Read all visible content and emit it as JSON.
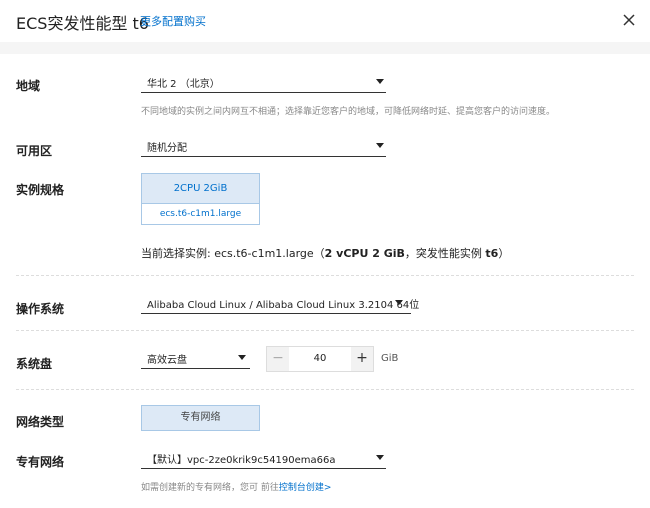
{
  "header": {
    "title": "ECS突发性能型 t6",
    "more_link": "更多配置购买"
  },
  "region": {
    "label": "地域",
    "value": "华北 2 （北京）",
    "hint": "不同地域的实例之间内网互不相通；选择靠近您客户的地域，可降低网络时延、提高您客户的访问速度。"
  },
  "zone": {
    "label": "可用区",
    "value": "随机分配"
  },
  "spec": {
    "label": "实例规格",
    "cpu_mem": "2CPU 2GiB",
    "type_name": "ecs.t6-c1m1.large",
    "current_prefix": "当前选择实例: ecs.t6-c1m1.large（",
    "current_bold": "2 vCPU 2 GiB",
    "current_mid": "，突发性能实例 ",
    "current_bold2": "t6",
    "current_suffix": "）"
  },
  "os": {
    "label": "操作系统",
    "value": "Alibaba Cloud Linux / Alibaba Cloud Linux 3.2104 64位"
  },
  "disk": {
    "label": "系统盘",
    "type": "高效云盘",
    "size": "40",
    "minus": "−",
    "plus": "+",
    "unit": "GiB"
  },
  "network_type": {
    "label": "网络类型",
    "value": "专有网络"
  },
  "vpc": {
    "label": "专有网络",
    "value": "【默认】vpc-2ze0krik9c54190ema66a",
    "hint_prefix": "如需创建新的专有网络，您可 前往",
    "hint_link": "控制台创建>"
  },
  "colors": {
    "accent": "#0070cc",
    "card_bg": "#dde9f6",
    "card_border": "#a8c8e6"
  }
}
